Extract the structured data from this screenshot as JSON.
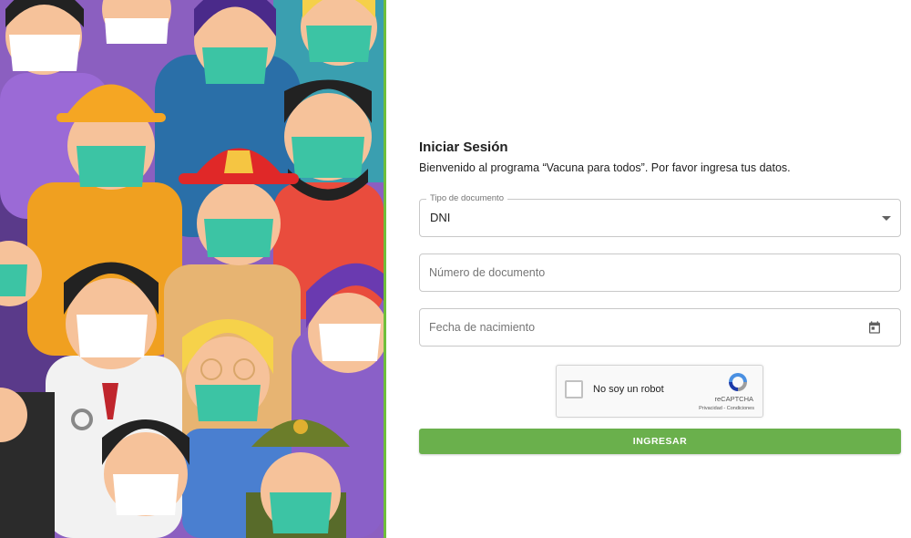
{
  "login": {
    "title": "Iniciar Sesión",
    "subtitle": "Bienvenido al programa “Vacuna para todos”. Por favor ingresa tus datos.",
    "doc_type": {
      "legend": "Tipo de documento",
      "value": "DNI"
    },
    "doc_number": {
      "placeholder": "Número de documento"
    },
    "birth_date": {
      "placeholder": "Fecha de nacimiento"
    },
    "captcha": {
      "label": "No soy un robot",
      "brand": "reCAPTCHA",
      "links": "Privacidad - Condiciones"
    },
    "submit_label": "INGRESAR"
  },
  "colors": {
    "accent": "#6ab04c",
    "border_green": "#6fbf3b",
    "mask": "#3cc4a4"
  },
  "icons": [
    "calendar-icon",
    "dropdown-arrow-icon",
    "recaptcha-logo-icon"
  ]
}
